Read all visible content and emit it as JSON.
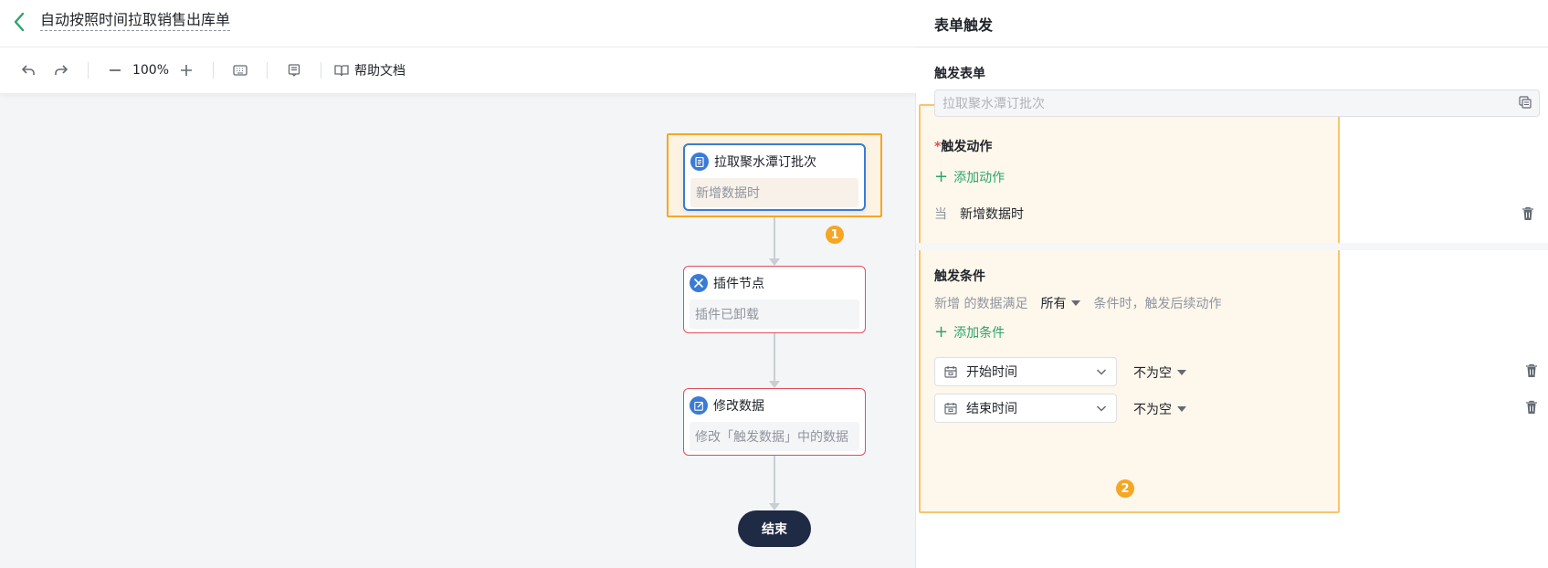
{
  "header": {
    "title": "自动按照时间拉取销售出库单"
  },
  "toolbar": {
    "zoom": "100%",
    "help_label": "帮助文档"
  },
  "flow": {
    "nodes": [
      {
        "title": "拉取聚水潭订批次",
        "body": "新增数据时"
      },
      {
        "title": "插件节点",
        "body": "插件已卸载"
      },
      {
        "title": "修改数据",
        "body": "修改「触发数据」中的数据"
      }
    ],
    "end_label": "结束",
    "badge_1": "1"
  },
  "panel": {
    "title": "表单触发",
    "form_label": "触发表单",
    "form_value": "拉取聚水潭订批次",
    "action_label": "触发动作",
    "required_mark": "*",
    "add_action": "添加动作",
    "action_when": "当",
    "action_value": "新增数据时",
    "condition_label": "触发条件",
    "cond_prefix": "新增 的数据满足",
    "cond_match": "所有",
    "cond_suffix": "条件时，触发后续动作",
    "add_condition": "添加条件",
    "conditions": [
      {
        "field": "开始时间",
        "operator": "不为空"
      },
      {
        "field": "结束时间",
        "operator": "不为空"
      }
    ],
    "badge_2": "2"
  },
  "colors": {
    "accent_green": "#2ea36b",
    "node_blue": "#3a7bd5",
    "error_red": "#e34d59",
    "highlight_orange": "#f5a623",
    "end_node": "#1f2a44"
  }
}
